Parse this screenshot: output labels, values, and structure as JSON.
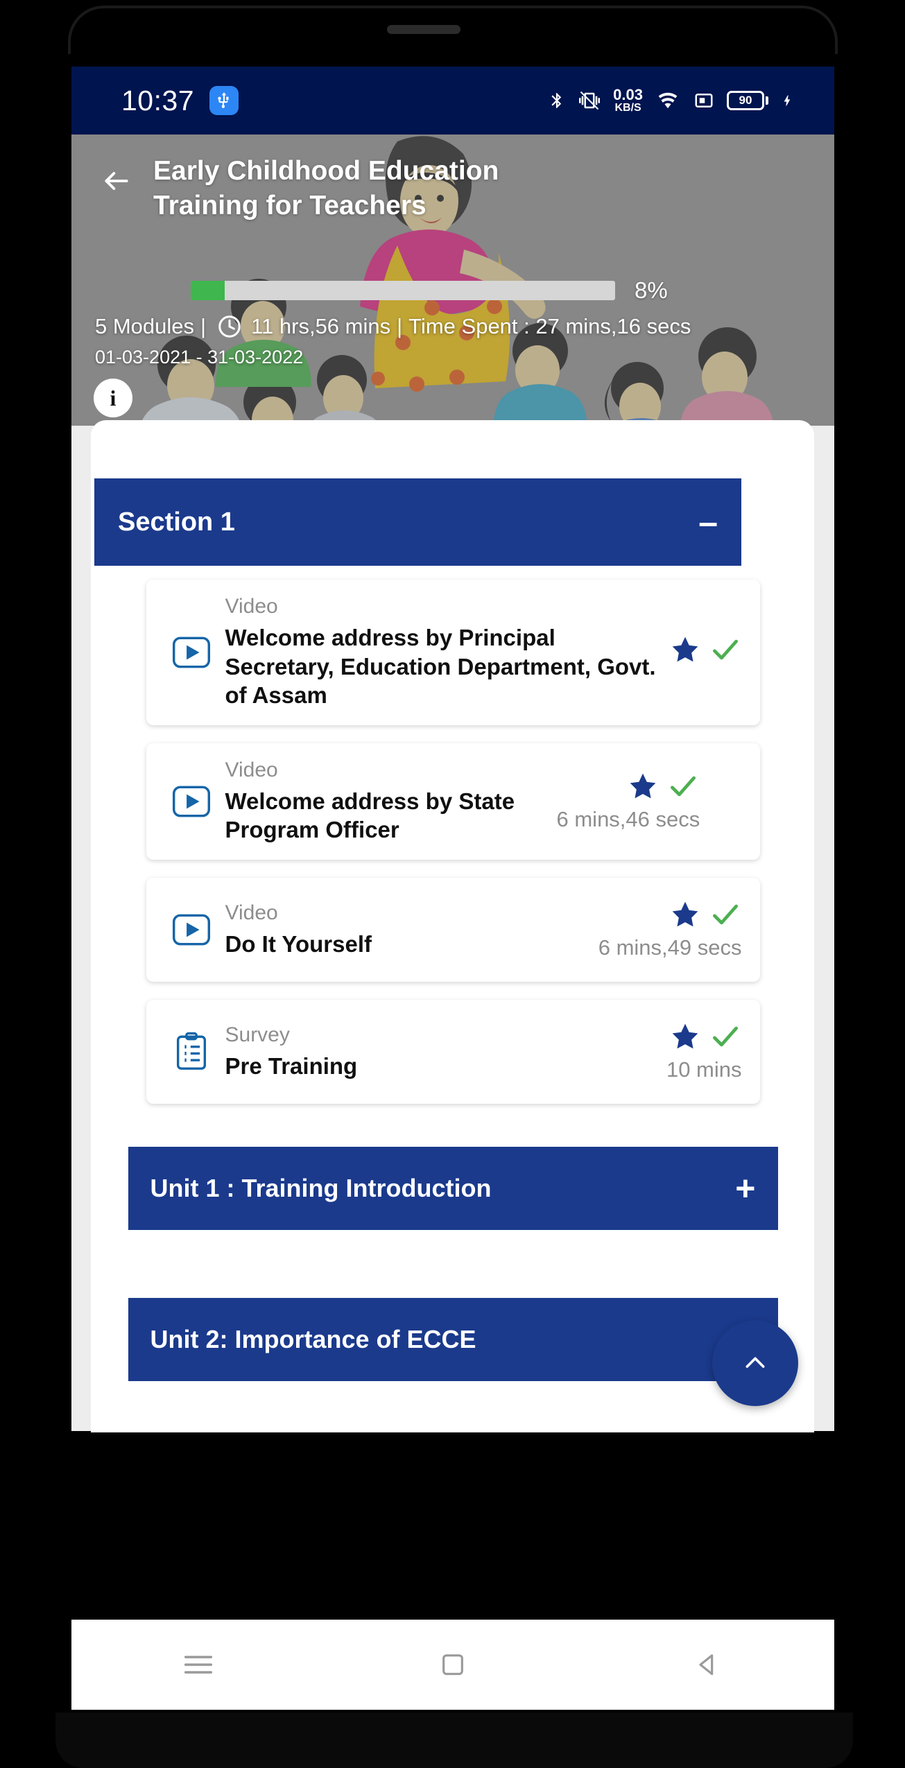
{
  "status_bar": {
    "time": "10:37",
    "usb_icon": "usb-icon",
    "bluetooth_icon": "bluetooth-icon",
    "mute_icon": "vibrate-mute-icon",
    "net_speed_value": "0.03",
    "net_speed_unit": "KB/S",
    "wifi_icon": "wifi-icon",
    "sim_icon": "sim-card-icon",
    "battery_level": "90",
    "charging_icon": "charging-bolt-icon"
  },
  "hero": {
    "back_icon": "back-arrow-icon",
    "title": "Early Childhood Education Training for Teachers",
    "progress_percent_label": "8%",
    "progress_percent_value": 8,
    "modules": "5 Modules",
    "clock_icon": "clock-icon",
    "duration": "11 hrs,56 mins",
    "time_spent": "Time Spent : 27 mins,16 secs",
    "separator": "|",
    "date_range": "01-03-2021 - 31-03-2022",
    "info_icon": "info-icon",
    "info_label": "i"
  },
  "section": {
    "title": "Section 1",
    "collapse_sign": "–"
  },
  "cards": [
    {
      "kind": "Video",
      "icon": "video-play-icon",
      "title": "Welcome address by Principal Secretary, Education Department, Govt. of Assam",
      "star_icon": "star-icon",
      "check_icon": "check-icon",
      "duration": ""
    },
    {
      "kind": "Video",
      "icon": "video-play-icon",
      "title": "Welcome address by State Program Officer",
      "star_icon": "star-icon",
      "check_icon": "check-icon",
      "duration": "6 mins,46 secs"
    },
    {
      "kind": "Video",
      "icon": "video-play-icon",
      "title": "Do It Yourself",
      "star_icon": "star-icon",
      "check_icon": "check-icon",
      "duration": "6 mins,49 secs"
    },
    {
      "kind": "Survey",
      "icon": "survey-clipboard-icon",
      "title": "Pre Training",
      "star_icon": "star-icon",
      "check_icon": "check-icon",
      "duration": "10 mins"
    }
  ],
  "units": [
    {
      "title": "Unit 1 : Training Introduction",
      "sign": "+"
    },
    {
      "title": "Unit 2: Importance of ECCE",
      "sign": "+"
    }
  ],
  "fab": {
    "icon": "chevron-up-icon"
  },
  "navbar": {
    "menu_icon": "menu-icon",
    "home_icon": "home-square-icon",
    "back_icon": "back-triangle-icon"
  },
  "colors": {
    "status_bar": "#00144f",
    "primary_blue": "#1b3a8c",
    "progress_green": "#3fb64e",
    "check_green": "#4caf50",
    "star_blue": "#1b3a8c",
    "hero_bg": "#8a8a8a"
  }
}
